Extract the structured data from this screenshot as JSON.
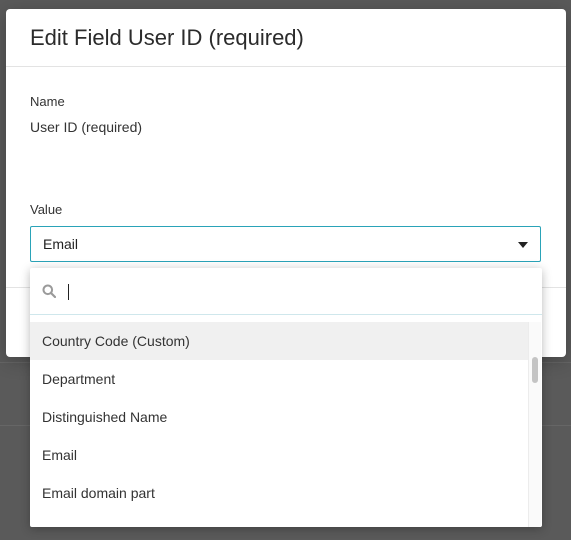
{
  "dialog": {
    "title": "Edit Field User ID (required)",
    "name_label": "Name",
    "name_value": "User ID (required)",
    "value_label": "Value",
    "selected_value": "Email"
  },
  "dropdown": {
    "search_placeholder": "",
    "options": [
      {
        "label": "Country Code (Custom)",
        "highlighted": true
      },
      {
        "label": "Department",
        "highlighted": false
      },
      {
        "label": "Distinguished Name",
        "highlighted": false
      },
      {
        "label": "Email",
        "highlighted": false
      },
      {
        "label": "Email domain part",
        "highlighted": false
      }
    ]
  },
  "colors": {
    "accent": "#2aa3b8",
    "overlay": "#5a5a5a"
  },
  "icons": {
    "search": "search-icon",
    "caret": "caret-down-icon"
  }
}
